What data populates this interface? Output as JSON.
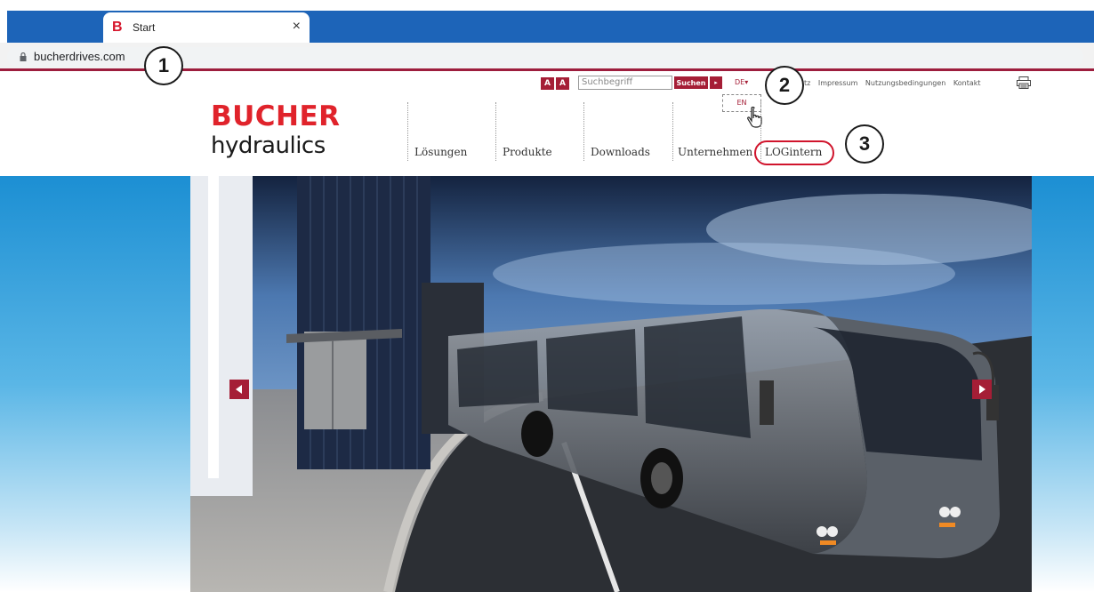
{
  "browser": {
    "tab_title": "Start",
    "tab_favicon": "B",
    "tab_close": "×",
    "url": "bucherdrives.com"
  },
  "callouts": [
    "1",
    "2",
    "3"
  ],
  "utility": {
    "font_small": "A",
    "font_large": "A",
    "search_placeholder": "Suchbegriff",
    "search_button": "Suchen",
    "search_arrow": "▸",
    "language_selected": "DE",
    "language_option": "EN",
    "links": [
      "tz",
      "Impressum",
      "Nutzungsbedingungen",
      "Kontakt"
    ]
  },
  "logo": {
    "top": "BUCHER",
    "bottom": "hydraulics"
  },
  "nav": {
    "items": [
      "Lösungen",
      "Produkte",
      "Downloads",
      "Unternehmen",
      "LOGintern"
    ]
  },
  "colors": {
    "brand_red": "#a51e36",
    "logo_red": "#e0232b",
    "chrome_blue": "#1d64b8",
    "annotation_red": "#d0142c"
  },
  "icons": {
    "lock": "lock-icon",
    "print": "printer-icon",
    "hand": "hand-pointer-icon",
    "prev": "chevron-left-icon",
    "next": "chevron-right-icon"
  }
}
